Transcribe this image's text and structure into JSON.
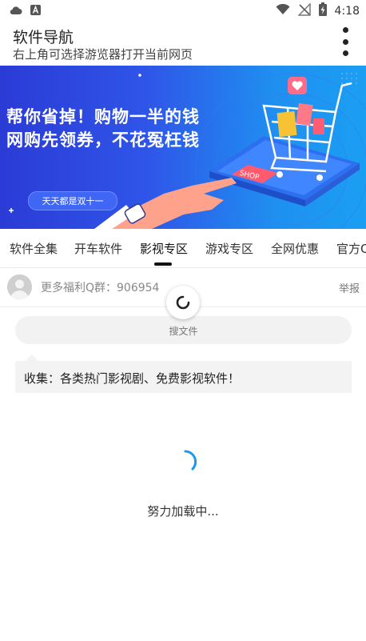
{
  "status_bar": {
    "time": "4:18",
    "left_icons": [
      "cloud-icon",
      "app-a-icon"
    ],
    "right_icons": [
      "wifi-icon",
      "no-signal-icon",
      "battery-charging-icon"
    ]
  },
  "header": {
    "title": "软件导航",
    "subtitle": "右上角可选择游览器打开当前网页",
    "menu_icon": "more-vertical-icon"
  },
  "banner": {
    "line1": "帮你省掉！购物一半的钱",
    "line2": "网购先领券，不花冤枉钱",
    "pill": "天天都是双十一",
    "phone_label": "SHOP",
    "colors": {
      "start": "#2b3bd6",
      "end": "#1b9ff2"
    }
  },
  "tabs": {
    "items": [
      {
        "label": "软件全集"
      },
      {
        "label": "开车软件"
      },
      {
        "label": "影视专区"
      },
      {
        "label": "游戏专区"
      },
      {
        "label": "全网优惠"
      },
      {
        "label": "官方Q"
      }
    ],
    "active_index": 2
  },
  "post": {
    "title": "更多福利Q群：906954",
    "report": "举报"
  },
  "search": {
    "label": "搜文件"
  },
  "notice": {
    "text": "收集：各类热门影视剧、免费影视软件！"
  },
  "loading": {
    "text": "努力加载中...",
    "spinner_color": "#1a9be8"
  }
}
